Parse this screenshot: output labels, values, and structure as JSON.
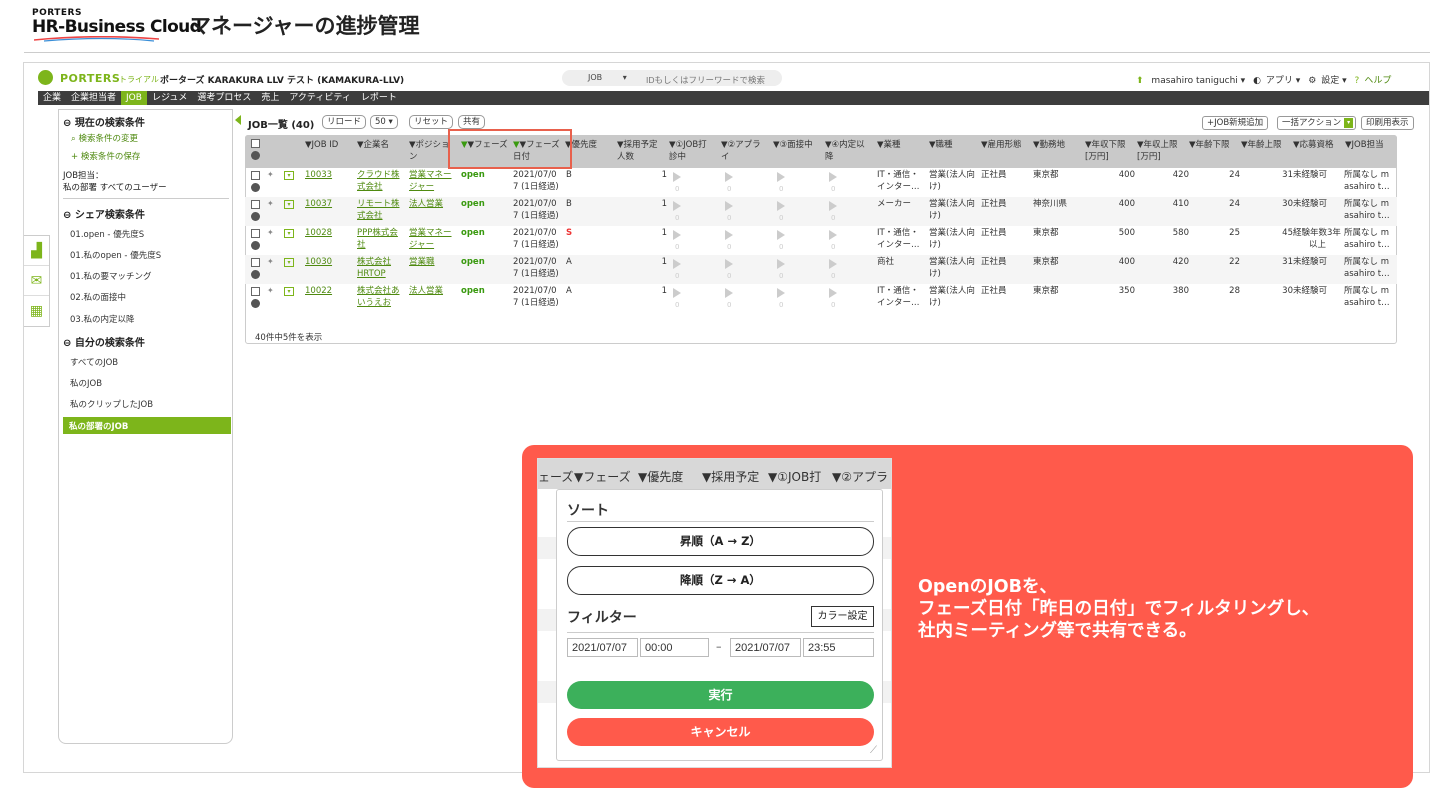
{
  "header": {
    "brand_small": "PORTERS",
    "brand_name": "HR-Business Cloud",
    "title": "マネージャーの進捗管理"
  },
  "app": {
    "logo": "PORTERS",
    "trial": "トライアル",
    "company": "ポーターズ KARAKURA LLV テスト (KAMAKURA-LLV)",
    "search_type": "JOB",
    "search_placeholder": "IDもしくはフリーワードで検索",
    "user": "masahiro taniguchi ▾",
    "apps": "アプリ ▾",
    "settings": "設定 ▾",
    "help": "ヘルプ"
  },
  "nav": [
    "企業",
    "企業担当者",
    "JOB",
    "レジュメ",
    "選考プロセス",
    "売上",
    "アクティビティ",
    "レポート"
  ],
  "nav_active_index": 2,
  "sidebar": {
    "current_title": "現在の検索条件",
    "change_link": "検索条件の変更",
    "save_link": "検索条件の保存",
    "owner_label": "JOB担当：",
    "owner_value": "私の部署 すべてのユーザー",
    "share_title": "シェア検索条件",
    "share_items": [
      "01.open - 優先度S",
      "01.私のopen - 優先度S",
      "01.私の要マッチング",
      "02.私の面接中",
      "03.私の内定以降"
    ],
    "own_title": "自分の検索条件",
    "own_items": [
      "すべてのJOB",
      "私のJOB",
      "私のクリップしたJOB"
    ],
    "own_selected": "私の部署のJOB"
  },
  "list": {
    "title": "JOB一覧 (40)",
    "reload": "リロード",
    "per_page": "50 ▾",
    "reset": "リセット",
    "share": "共有",
    "new_btn": "+JOB新規追加",
    "bulk_btn": "一括アクション",
    "print_btn": "印刷用表示",
    "count_text": "40件中5件を表示"
  },
  "columns": {
    "job_id": "▼JOB ID",
    "company": "▼企業名",
    "position_1": "▼ポジショ",
    "position_2": "ン",
    "phase": "▼フェーズ",
    "phase_date_1": "▼フェーズ",
    "phase_date_2": "日付",
    "priority": "▼優先度",
    "planned_1": "▼採用予定",
    "planned_2": "人数",
    "s1_1": "▼①JOB打",
    "s1_2": "診中",
    "s2_1": "▼②アプラ",
    "s2_2": "イ",
    "s3": "▼③面接中",
    "s4_1": "▼④内定以",
    "s4_2": "降",
    "industry": "▼業種",
    "occupation": "▼職種",
    "employment": "▼雇用形態",
    "location": "▼勤務地",
    "sal_min_1": "▼年収下限",
    "sal_min_2": "[万円]",
    "sal_max_1": "▼年収上限",
    "sal_max_2": "[万円]",
    "age_min": "▼年齢下限",
    "age_max": "▼年齢上限",
    "qualification": "▼応募資格",
    "owner": "▼JOB担当"
  },
  "rows": [
    {
      "id": "10033",
      "c1": "クラウド株",
      "c2": "式会社",
      "p1": "営業マネー",
      "p2": "ジャー",
      "phase": "open",
      "d1": "2021/07/0",
      "d2": "7 (1日経過)",
      "prio": "B",
      "num": "1",
      "ind1": "IT・通信・",
      "ind2": "インター…",
      "occ1": "営業(法人向",
      "occ2": "け)",
      "emp": "正社員",
      "loc": "東京都",
      "smin": "400",
      "smax": "420",
      "amin": "24",
      "amax": "31",
      "q1": "未経験可",
      "q2": "",
      "o1": "所属なし m",
      "o2": "asahiro t…"
    },
    {
      "id": "10037",
      "c1": "リモート株",
      "c2": "式会社",
      "p1": "法人営業",
      "p2": "",
      "phase": "open",
      "d1": "2021/07/0",
      "d2": "7 (1日経過)",
      "prio": "B",
      "num": "1",
      "ind1": "メーカー",
      "ind2": "",
      "occ1": "営業(法人向",
      "occ2": "け)",
      "emp": "正社員",
      "loc": "神奈川県",
      "smin": "400",
      "smax": "410",
      "amin": "24",
      "amax": "30",
      "q1": "未経験可",
      "q2": "",
      "o1": "所属なし m",
      "o2": "asahiro t…"
    },
    {
      "id": "10028",
      "c1": "PPP株式会",
      "c2": "社",
      "p1": "営業マネー",
      "p2": "ジャー",
      "phase": "open",
      "d1": "2021/07/0",
      "d2": "7 (1日経過)",
      "prio": "S",
      "num": "1",
      "ind1": "IT・通信・",
      "ind2": "インター…",
      "occ1": "営業(法人向",
      "occ2": "け)",
      "emp": "正社員",
      "loc": "東京都",
      "smin": "500",
      "smax": "580",
      "amin": "25",
      "amax": "45",
      "q1": "経験年数3年",
      "q2": "以上",
      "o1": "所属なし m",
      "o2": "asahiro t…"
    },
    {
      "id": "10030",
      "c1": "株式会社",
      "c2": "HRTOP",
      "p1": "営業職",
      "p2": "",
      "phase": "open",
      "d1": "2021/07/0",
      "d2": "7 (1日経過)",
      "prio": "A",
      "num": "1",
      "ind1": "商社",
      "ind2": "",
      "occ1": "営業(法人向",
      "occ2": "け)",
      "emp": "正社員",
      "loc": "東京都",
      "smin": "400",
      "smax": "420",
      "amin": "22",
      "amax": "31",
      "q1": "未経験可",
      "q2": "",
      "o1": "所属なし m",
      "o2": "asahiro t…"
    },
    {
      "id": "10022",
      "c1": "株式会社あ",
      "c2": "いうえお",
      "p1": "法人営業",
      "p2": "",
      "phase": "open",
      "d1": "2021/07/0",
      "d2": "7 (1日経過)",
      "prio": "A",
      "num": "1",
      "ind1": "IT・通信・",
      "ind2": "インター…",
      "occ1": "営業(法人向",
      "occ2": "け)",
      "emp": "正社員",
      "loc": "東京都",
      "smin": "350",
      "smax": "380",
      "amin": "28",
      "amax": "30",
      "q1": "未経験可",
      "q2": "",
      "o1": "所属なし m",
      "o2": "asahiro t…"
    }
  ],
  "popup": {
    "header_cols": [
      "ェーズ",
      "▼フェーズ",
      "▼優先度",
      "▼採用予定",
      "▼①JOB打",
      "▼②アプラ"
    ],
    "sort_title": "ソート",
    "asc": "昇順（A → Z）",
    "desc": "降順（Z → A）",
    "filter_title": "フィルター",
    "color_btn": "カラー設定",
    "from_date": "2021/07/07",
    "from_time": "00:00",
    "dash": "–",
    "to_date": "2021/07/07",
    "to_time": "23:55",
    "run": "実行",
    "cancel": "キャンセル"
  },
  "callout": {
    "line1": "OpenのJOBを、",
    "line2": "フェーズ日付「昨日の日付」でフィルタリングし、",
    "line3": "社内ミーティング等で共有できる。"
  },
  "colors": {
    "accent": "#7db51b",
    "nav_bg": "#3d3d3d",
    "overlay": "#ff5a4b",
    "run": "#3cb05b",
    "cancel": "#ff5a4b"
  }
}
